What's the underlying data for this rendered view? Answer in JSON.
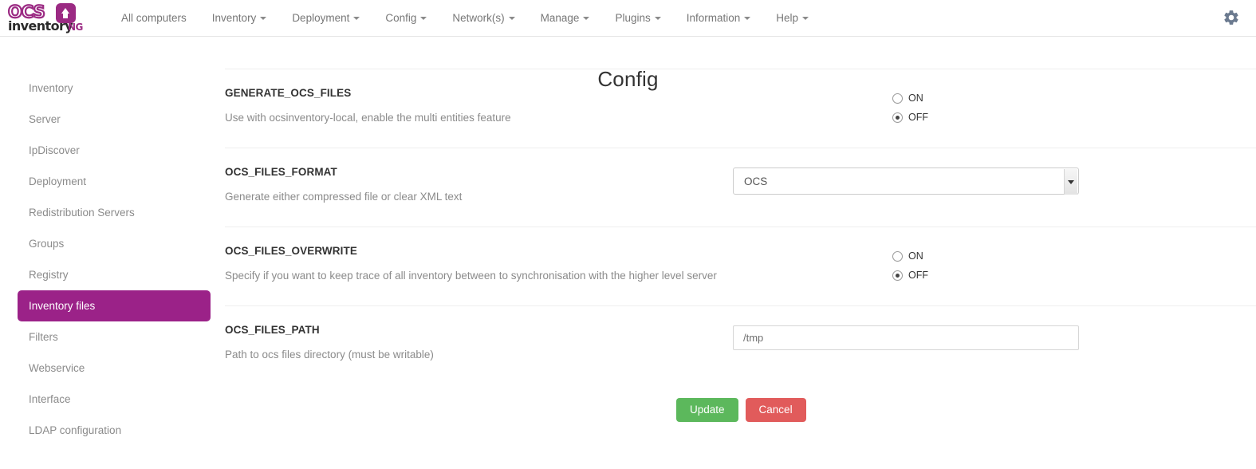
{
  "brand": {
    "name_top": "OCS",
    "name_bottom": "inventory",
    "suffix": "NG",
    "badge_icon": "upload-arrow-icon",
    "accent_color": "#9b2a83"
  },
  "navbar": {
    "items": [
      {
        "label": "All computers",
        "has_caret": false
      },
      {
        "label": "Inventory",
        "has_caret": true
      },
      {
        "label": "Deployment",
        "has_caret": true
      },
      {
        "label": "Config",
        "has_caret": true
      },
      {
        "label": "Network(s)",
        "has_caret": true
      },
      {
        "label": "Manage",
        "has_caret": true
      },
      {
        "label": "Plugins",
        "has_caret": true
      },
      {
        "label": "Information",
        "has_caret": true
      },
      {
        "label": "Help",
        "has_caret": true
      }
    ],
    "settings_icon": "gear-icon"
  },
  "sidebar": {
    "items": [
      {
        "label": "Inventory",
        "active": false
      },
      {
        "label": "Server",
        "active": false
      },
      {
        "label": "IpDiscover",
        "active": false
      },
      {
        "label": "Deployment",
        "active": false
      },
      {
        "label": "Redistribution Servers",
        "active": false
      },
      {
        "label": "Groups",
        "active": false
      },
      {
        "label": "Registry",
        "active": false
      },
      {
        "label": "Inventory files",
        "active": true
      },
      {
        "label": "Filters",
        "active": false
      },
      {
        "label": "Webservice",
        "active": false
      },
      {
        "label": "Interface",
        "active": false
      },
      {
        "label": "LDAP configuration",
        "active": false
      }
    ],
    "active_bg_color": "#9b2288"
  },
  "main": {
    "title": "Config",
    "settings": [
      {
        "name": "GENERATE_OCS_FILES",
        "description": "Use with ocsinventory-local, enable the multi entities feature",
        "control": "radio",
        "options": [
          {
            "label": "ON",
            "checked": false
          },
          {
            "label": "OFF",
            "checked": true
          }
        ]
      },
      {
        "name": "OCS_FILES_FORMAT",
        "description": "Generate either compressed file or clear XML text",
        "control": "select",
        "value": "OCS"
      },
      {
        "name": "OCS_FILES_OVERWRITE",
        "description": "Specify if you want to keep trace of all inventory between to synchronisation with the higher level server",
        "control": "radio",
        "options": [
          {
            "label": "ON",
            "checked": false
          },
          {
            "label": "OFF",
            "checked": true
          }
        ]
      },
      {
        "name": "OCS_FILES_PATH",
        "description": "Path to ocs files directory (must be writable)",
        "control": "text",
        "value": "/tmp",
        "placeholder": ""
      }
    ],
    "buttons": {
      "update_label": "Update",
      "cancel_label": "Cancel",
      "update_color": "#5cb85c",
      "cancel_color": "#e15b5b"
    }
  }
}
